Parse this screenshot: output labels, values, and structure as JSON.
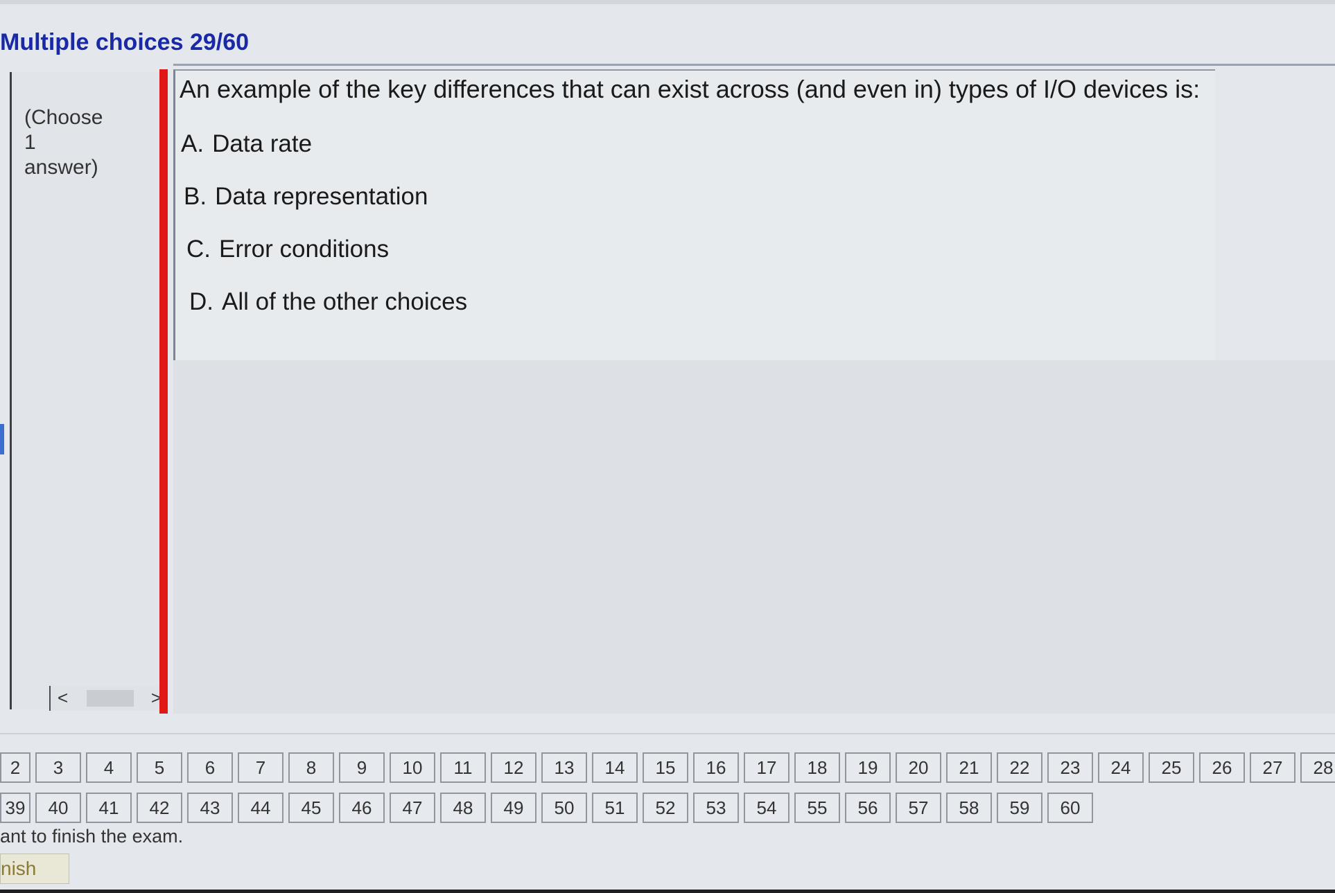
{
  "header": {
    "title": "Multiple choices 29/60"
  },
  "sidebar": {
    "hint_line1": "(Choose",
    "hint_line2": "1",
    "hint_line3": "answer)"
  },
  "scrollbar": {
    "left_arrow": "<",
    "right_arrow": ">"
  },
  "question": {
    "text": "An example of the key differences that can exist across (and even in) types of I/O devices is:",
    "options": [
      {
        "letter": "A.",
        "label": "Data rate"
      },
      {
        "letter": "B.",
        "label": "Data representation"
      },
      {
        "letter": "C.",
        "label": "Error conditions"
      },
      {
        "letter": "D.",
        "label": "All of the other choices"
      }
    ]
  },
  "navigation": {
    "row1": [
      "2",
      "3",
      "4",
      "5",
      "6",
      "7",
      "8",
      "9",
      "10",
      "11",
      "12",
      "13",
      "14",
      "15",
      "16",
      "17",
      "18",
      "19",
      "20",
      "21",
      "22",
      "23",
      "24",
      "25",
      "26",
      "27",
      "28"
    ],
    "row2": [
      "39",
      "40",
      "41",
      "42",
      "43",
      "44",
      "45",
      "46",
      "47",
      "48",
      "49",
      "50",
      "51",
      "52",
      "53",
      "54",
      "55",
      "56",
      "57",
      "58",
      "59",
      "60"
    ]
  },
  "footer": {
    "note": "ant to finish the exam.",
    "finish_label": "nish"
  },
  "colors": {
    "title": "#1a2aa6",
    "question_bar": "#e01818"
  }
}
